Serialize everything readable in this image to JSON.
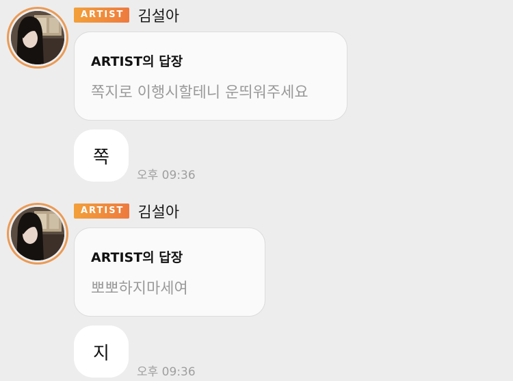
{
  "messages": [
    {
      "badge": "ARTIST",
      "sender": "김설아",
      "reply_title": "ARTIST의 답장",
      "reply_body": "쪽지로 이행시할테니 운띄워주세요",
      "bubble_text": "쪽",
      "time": "오후 09:36"
    },
    {
      "badge": "ARTIST",
      "sender": "김설아",
      "reply_title": "ARTIST의 답장",
      "reply_body": "뽀뽀하지마세여",
      "bubble_text": "지",
      "time": "오후 09:36"
    }
  ],
  "colors": {
    "background": "#ededed",
    "badge_start": "#f2a03a",
    "badge_end": "#ee7a3e",
    "avatar_ring": "#ea9a55"
  }
}
